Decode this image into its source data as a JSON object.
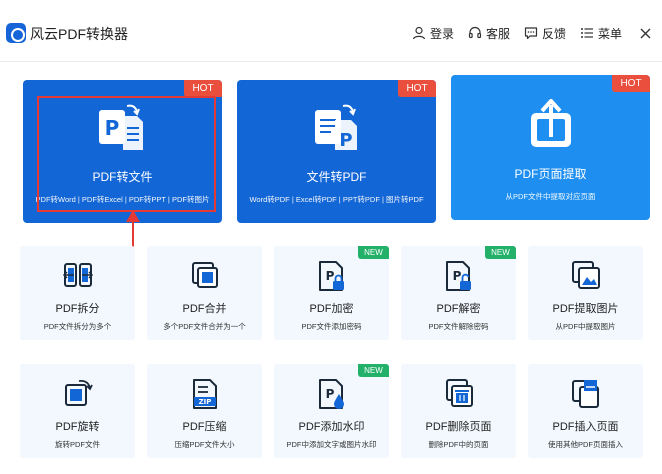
{
  "app": {
    "title": "风云PDF转换器"
  },
  "nav": {
    "login": "登录",
    "service": "客服",
    "feedback": "反馈",
    "menu": "菜单"
  },
  "hero": [
    {
      "title": "PDF转文件",
      "sub": "PDF转Word | PDF转Excel | PDF转PPT | PDF转图片",
      "badge": "HOT"
    },
    {
      "title": "文件转PDF",
      "sub": "Word转PDF | Excel转PDF | PPT转PDF | 图片转PDF",
      "badge": "HOT"
    },
    {
      "title": "PDF页面提取",
      "sub": "从PDF文件中提取对应页面",
      "badge": "HOT"
    }
  ],
  "tools": [
    {
      "title": "PDF拆分",
      "sub": "PDF文件拆分为多个"
    },
    {
      "title": "PDF合并",
      "sub": "多个PDF文件合并为一个"
    },
    {
      "title": "PDF加密",
      "sub": "PDF文件添加密码",
      "badge": "NEW"
    },
    {
      "title": "PDF解密",
      "sub": "PDF文件解除密码",
      "badge": "NEW"
    },
    {
      "title": "PDF提取图片",
      "sub": "从PDF中提取图片"
    },
    {
      "title": "PDF旋转",
      "sub": "旋转PDF文件"
    },
    {
      "title": "PDF压缩",
      "sub": "压缩PDF文件大小",
      "icon_label": "ZIP"
    },
    {
      "title": "PDF添加水印",
      "sub": "PDF中添加文字或图片水印",
      "badge": "NEW"
    },
    {
      "title": "PDF删除页面",
      "sub": "删除PDF中的页面"
    },
    {
      "title": "PDF插入页面",
      "sub": "使用其他PDF页面插入"
    }
  ],
  "colors": {
    "primary": "#1366d6",
    "secondary": "#1e8ff0",
    "hot": "#ea4e3d",
    "new": "#23b16a",
    "tile_bg": "#f2f8fd",
    "annotation": "#e53935"
  }
}
